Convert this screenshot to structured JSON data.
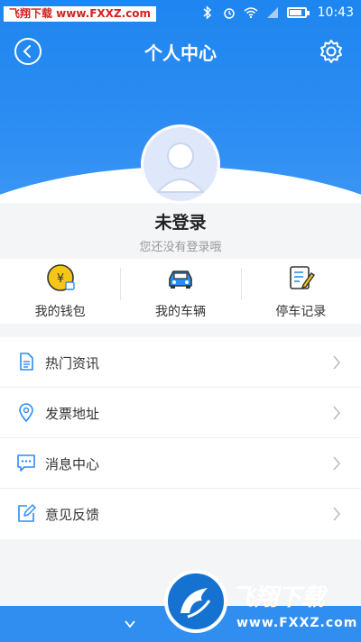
{
  "status_bar": {
    "watermark": "飞翔下载 www.FXXZ.com",
    "time": "10:43"
  },
  "nav": {
    "title": "个人中心"
  },
  "profile": {
    "name": "未登录",
    "subtitle": "您还没有登录哦"
  },
  "quick_actions": [
    {
      "label": "我的钱包",
      "icon": "wallet-icon"
    },
    {
      "label": "我的车辆",
      "icon": "car-icon"
    },
    {
      "label": "停车记录",
      "icon": "parking-record-icon"
    }
  ],
  "menu": [
    {
      "label": "热门资讯",
      "icon": "document-icon"
    },
    {
      "label": "发票地址",
      "icon": "location-pin-icon"
    },
    {
      "label": "消息中心",
      "icon": "message-icon"
    },
    {
      "label": "意见反馈",
      "icon": "edit-icon"
    }
  ],
  "brand": {
    "name": "飞翔下载",
    "url": "www.FXXZ.com"
  },
  "colors": {
    "primary": "#2c8cf2",
    "accent_yellow": "#f5c518"
  }
}
